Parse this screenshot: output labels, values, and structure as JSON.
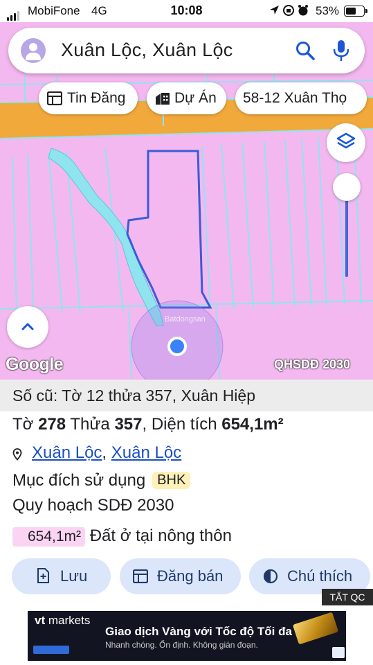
{
  "status_bar": {
    "carrier": "MobiFone",
    "network": "4G",
    "time": "10:08",
    "battery_pct": "53%"
  },
  "search": {
    "query": "Xuân Lộc, Xuân Lộc"
  },
  "chips": [
    {
      "label": "Tin Đăng",
      "icon": "listing-icon"
    },
    {
      "label": "Dự Án",
      "icon": "buildings-icon"
    },
    {
      "label": "58-12 Xuân Thọ",
      "icon": ""
    }
  ],
  "map": {
    "attribution": "Google",
    "layer_label": "QHSDĐ 2030",
    "watermark": "Batdongsan",
    "colors": {
      "residential": "#f4b8f0",
      "road": "#f2a93b",
      "parcel_border": "#3b5bd6",
      "water": "#8fe4ef"
    }
  },
  "parcel": {
    "old_info": "Số cũ: Tờ 12 thửa 357, Xuân Hiệp",
    "sheet_label": "Tờ",
    "sheet_no": "278",
    "plot_label": "Thửa",
    "plot_no": "357",
    "area_label": "Diện tích",
    "area": "654,1m²",
    "location_1": "Xuân Lộc",
    "location_sep": ",",
    "location_2": "Xuân Lộc",
    "purpose_label": "Mục đích sử dụng",
    "purpose_code": "BHK",
    "plan_title": "Quy hoạch SDĐ 2030",
    "plan_area": "654,1m²",
    "plan_use": "Đất ở tại nông thôn"
  },
  "actions": {
    "save": "Lưu",
    "post_sale": "Đăng bán",
    "legend": "Chú thích"
  },
  "ad": {
    "close_label": "TẮT QC",
    "brand_bold": "vt",
    "brand_rest": "markets",
    "headline": "Giao dịch Vàng với Tốc độ Tối đa",
    "subline": "Nhanh chóng. Ổn định. Không gián đoạn."
  }
}
